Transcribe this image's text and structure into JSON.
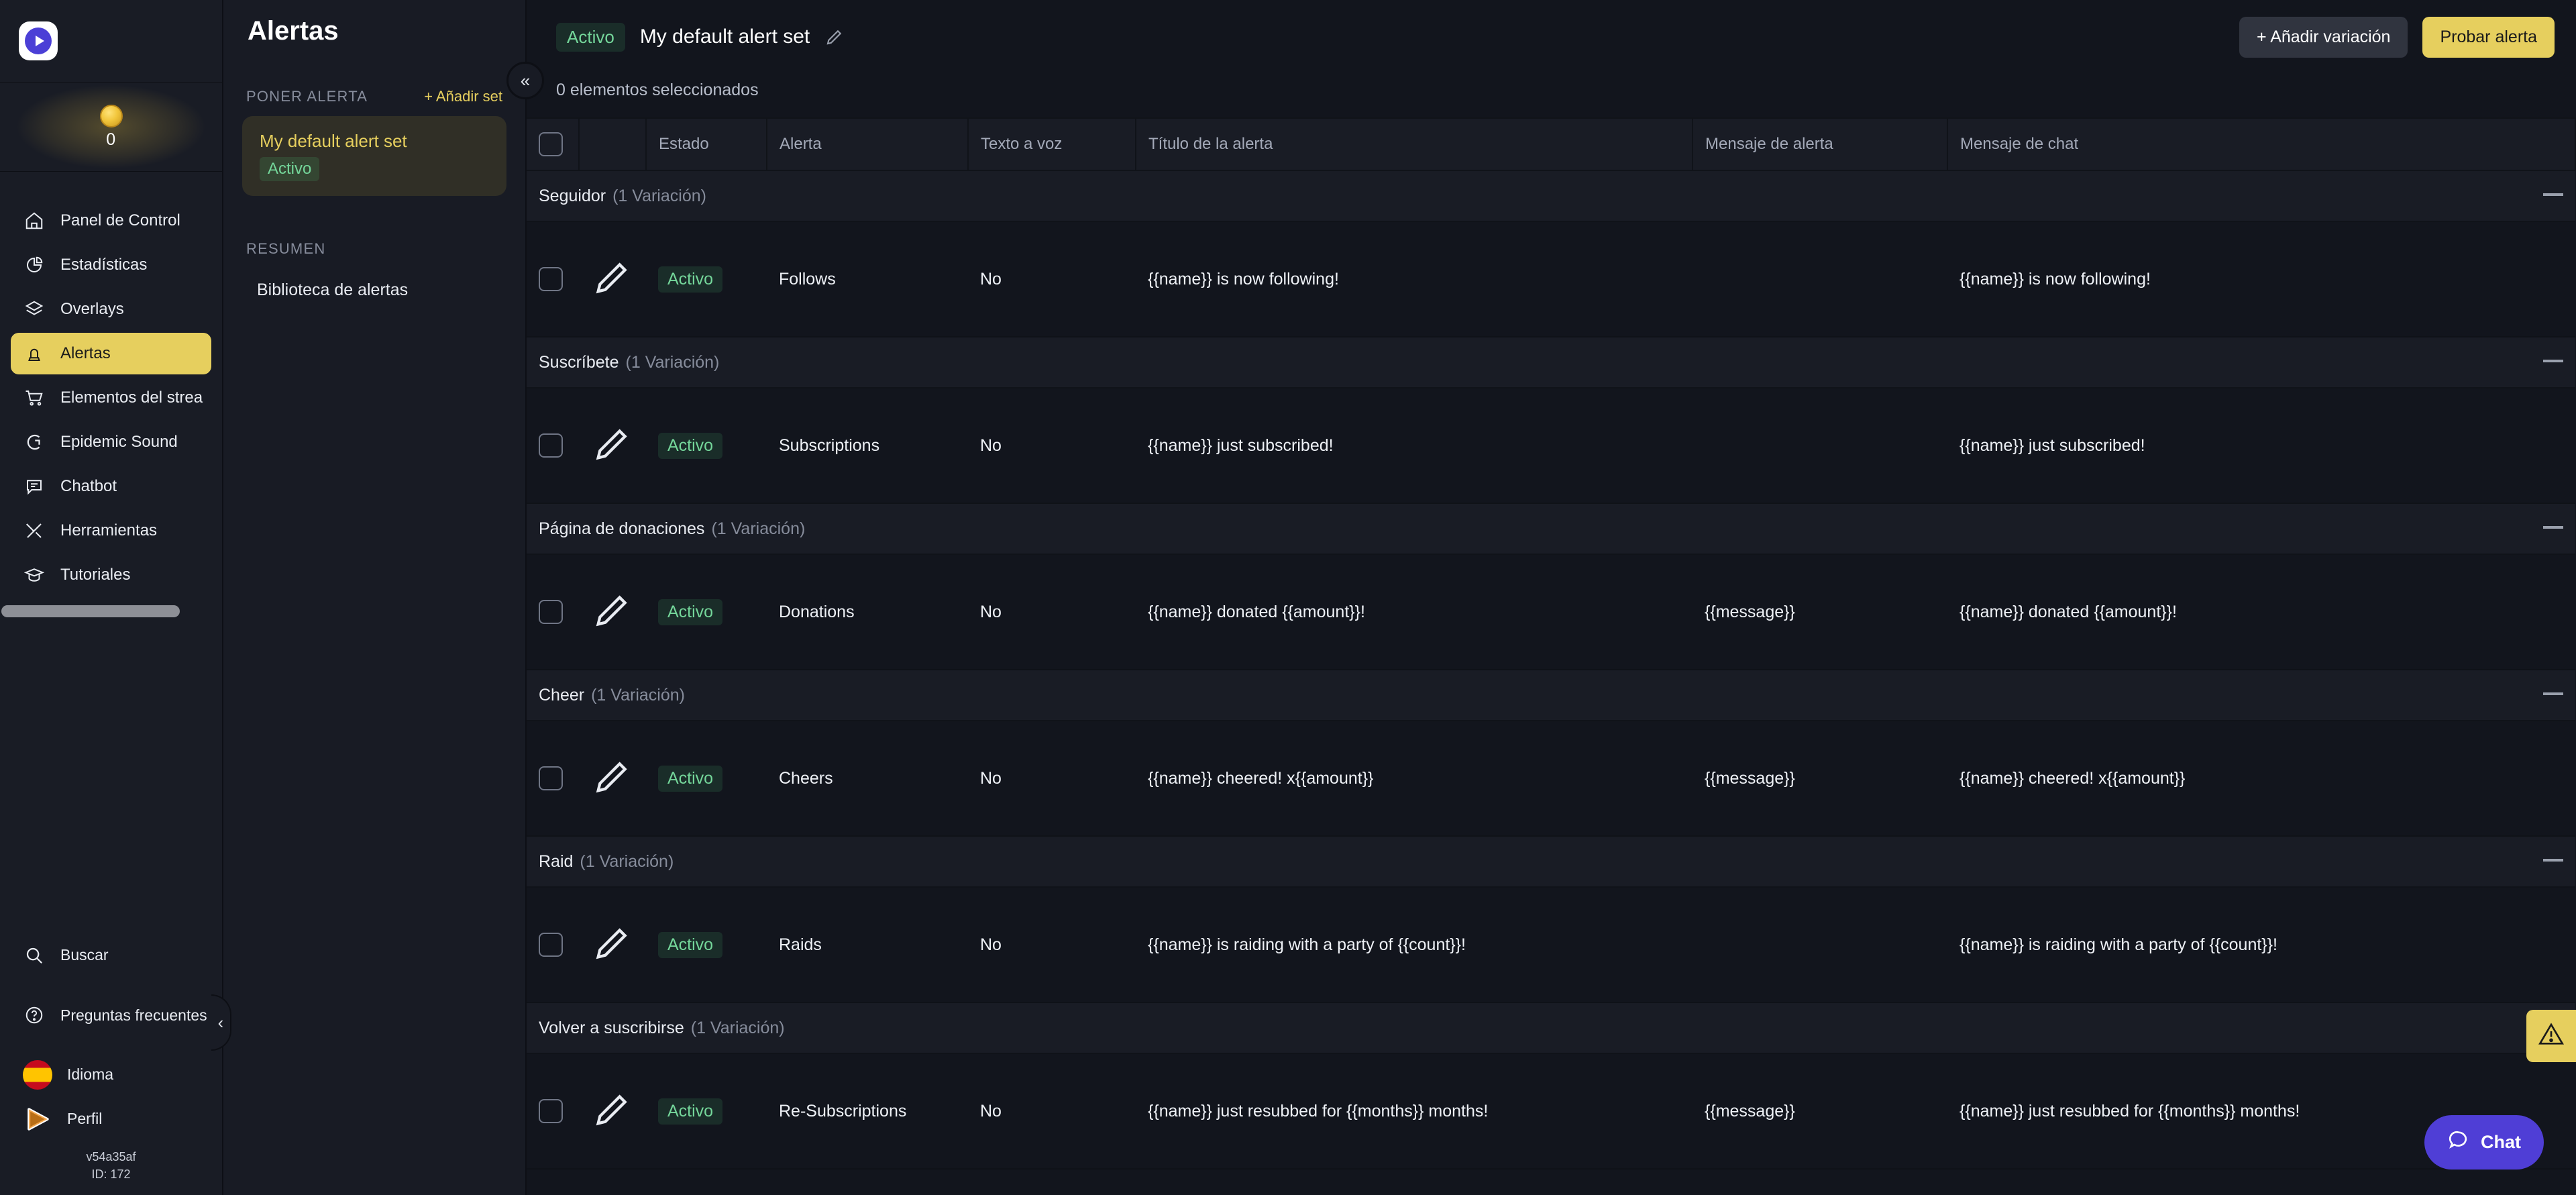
{
  "rail": {
    "logo_icon": "streamlabs-play-logo",
    "coin": {
      "icon": "gold-coin-icon",
      "count": "0"
    },
    "nav": [
      {
        "label": "Panel de Control",
        "icon": "home-icon",
        "active": false
      },
      {
        "label": "Estadísticas",
        "icon": "pie-chart-icon",
        "active": false
      },
      {
        "label": "Overlays",
        "icon": "layers-icon",
        "active": false
      },
      {
        "label": "Alertas",
        "icon": "alarm-light-icon",
        "active": true
      },
      {
        "label": "Elementos del strea",
        "icon": "shopping-cart-icon",
        "active": false
      },
      {
        "label": "Epidemic Sound",
        "icon": "epidemic-sound-icon",
        "active": false
      },
      {
        "label": "Chatbot",
        "icon": "chat-bubble-icon",
        "active": false
      },
      {
        "label": "Herramientas",
        "icon": "tools-icon",
        "active": false
      },
      {
        "label": "Tutoriales",
        "icon": "graduation-cap-icon",
        "active": false
      }
    ],
    "bottom": {
      "search_label": "Buscar",
      "faq_label": "Preguntas frecuentes (FAQ)",
      "language_label": "Idioma",
      "profile_label": "Perfil",
      "version": "v54a35af",
      "user_id": "ID: 172"
    },
    "collapse_icon": "chevron-left-icon"
  },
  "panel": {
    "title": "Alertas",
    "section_label": "PONER ALERTA",
    "add_set_label": "+ Añadir set",
    "alert_set": {
      "name": "My default alert set",
      "status": "Activo"
    },
    "summary_label": "RESUMEN",
    "library_label": "Biblioteca de alertas",
    "collapse_icon": "chevron-double-left-icon"
  },
  "topbar": {
    "status": "Activo",
    "set_name": "My default alert set",
    "edit_icon": "pencil-icon",
    "add_variation_label": "+ Añadir variación",
    "test_alert_label": "Probar alerta"
  },
  "table": {
    "selection_text": "0 elementos seleccionados",
    "headers": [
      "",
      "",
      "Estado",
      "Alerta",
      "Texto a voz",
      "Título de la alerta",
      "Mensaje de alerta",
      "Mensaje de chat"
    ],
    "variation_suffix": "(1 Variación)",
    "groups": [
      {
        "name": "Seguidor",
        "count": "(1 Variación)",
        "rows": [
          {
            "state": "Activo",
            "alert": "Follows",
            "tts": "No",
            "title": "{{name}} is now following!",
            "alert_message": "",
            "chat_message": "{{name}} is now following!"
          }
        ]
      },
      {
        "name": "Suscríbete",
        "count": "(1 Variación)",
        "rows": [
          {
            "state": "Activo",
            "alert": "Subscriptions",
            "tts": "No",
            "title": "{{name}} just subscribed!",
            "alert_message": "",
            "chat_message": "{{name}} just subscribed!"
          }
        ]
      },
      {
        "name": "Página de donaciones",
        "count": "(1 Variación)",
        "rows": [
          {
            "state": "Activo",
            "alert": "Donations",
            "tts": "No",
            "title": "{{name}} donated {{amount}}!",
            "alert_message": "{{message}}",
            "chat_message": "{{name}} donated {{amount}}!"
          }
        ]
      },
      {
        "name": "Cheer",
        "count": "(1 Variación)",
        "rows": [
          {
            "state": "Activo",
            "alert": "Cheers",
            "tts": "No",
            "title": "{{name}} cheered! x{{amount}}",
            "alert_message": "{{message}}",
            "chat_message": "{{name}} cheered! x{{amount}}"
          }
        ]
      },
      {
        "name": "Raid",
        "count": "(1 Variación)",
        "rows": [
          {
            "state": "Activo",
            "alert": "Raids",
            "tts": "No",
            "title": "{{name}} is raiding with a party of {{count}}!",
            "alert_message": "",
            "chat_message": "{{name}} is raiding with a party of {{count}}!"
          }
        ]
      },
      {
        "name": "Volver a suscribirse",
        "count": "(1 Variación)",
        "rows": [
          {
            "state": "Activo",
            "alert": "Re-Subscriptions",
            "tts": "No",
            "title": "{{name}} just resubbed for {{months}} months!",
            "alert_message": "{{message}}",
            "chat_message": "{{name}} just resubbed for {{months}} months!"
          }
        ]
      }
    ]
  },
  "floating": {
    "warning_icon": "warning-triangle-icon",
    "chat_label": "Chat",
    "chat_icon": "chat-bubble-icon"
  },
  "colors": {
    "accent_yellow": "#e6cf5e",
    "status_green": "#74d69a",
    "chat_purple": "#4f3ed6",
    "bg_dark": "#12151d",
    "bg_panel": "#191c25"
  }
}
